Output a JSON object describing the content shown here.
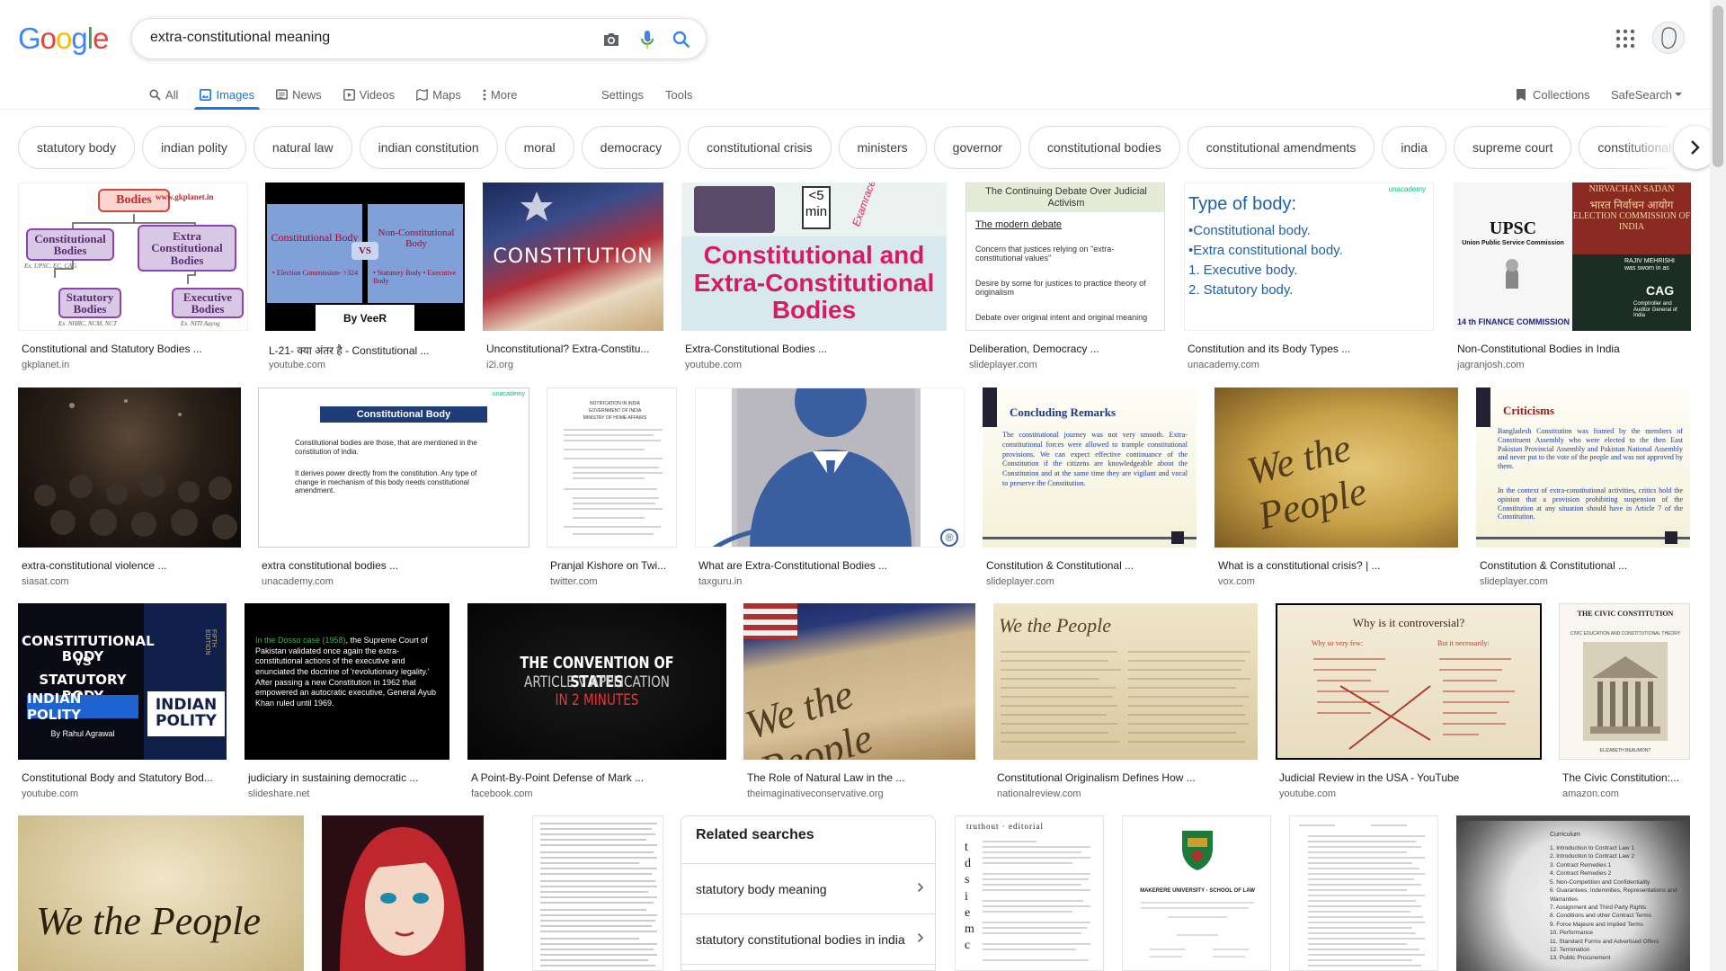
{
  "header": {
    "logo_text": "Google",
    "query": "extra-constitutional meaning",
    "tabs": [
      {
        "label": "All",
        "icon": "search-icon"
      },
      {
        "label": "Images",
        "icon": "image-icon"
      },
      {
        "label": "News",
        "icon": "news-icon"
      },
      {
        "label": "Videos",
        "icon": "video-icon"
      },
      {
        "label": "Maps",
        "icon": "map-icon"
      },
      {
        "label": "More",
        "icon": "more-vert-icon"
      }
    ],
    "settings_label": "Settings",
    "tools_label": "Tools",
    "collections_label": "Collections",
    "safesearch_label": "SafeSearch"
  },
  "chips": [
    "statutory body",
    "indian polity",
    "natural law",
    "indian constitution",
    "moral",
    "democracy",
    "constitutional crisis",
    "ministers",
    "governor",
    "constitutional bodies",
    "constitutional amendments",
    "india",
    "supreme court",
    "constitutional"
  ],
  "results": [
    {
      "caption": "Constitutional and Statutory Bodies ...",
      "source": "gkplanet.in",
      "thumb": {
        "t1": "Bodies",
        "t2": "www.gkplanet.in",
        "t3": "Constitutional Bodies",
        "t4": "Extra Constitutional Bodies",
        "t5": "Statutory Bodies",
        "t6": "Executive Bodies",
        "t7": "Ex. UPSC, EC, CAG",
        "t8": "Ex. NHRC, NCM, NCT",
        "t9": "Ex. NITI Aayog"
      }
    },
    {
      "caption": "L-21- क्या अंतर है - Constitutional ...",
      "source": "youtube.com",
      "thumb": {
        "t1": "Constitutional Body",
        "t2": "VS",
        "t3": "Non-Constitutional Body",
        "t4": "• Election Commission- >324",
        "t5": "• Statutory Body • Executive Body",
        "t6": "By VeeR"
      }
    },
    {
      "caption": "Unconstitutional? Extra-Constitu...",
      "source": "i2i.org",
      "thumb": {
        "t1": "CONSTITUTION"
      }
    },
    {
      "caption": "Extra-Constitutional Bodies ...",
      "source": "youtube.com",
      "thumb": {
        "t1": "<5 min",
        "t2": "Examrace",
        "t3": "Constitutional and Extra-Constitutional Bodies"
      }
    },
    {
      "caption": "Deliberation, Democracy ...",
      "source": "slideplayer.com",
      "thumb": {
        "t1": "The Continuing Debate Over Judicial Activism",
        "t2": "The modern debate",
        "t3": "Concern that justices relying on \"extra-constitutional values\"",
        "t4": "Desire by some for justices to practice theory of originalism",
        "t5": "Debate over original intent and original meaning"
      }
    },
    {
      "caption": "Constitution and its Body Types ...",
      "source": "unacademy.com",
      "thumb": {
        "t1": "Type of body:",
        "t2": "•Constitutional body.",
        "t3": "•Extra constitutional body.",
        "t4": "1.  Executive body.",
        "t5": "2.  Statutory body.",
        "t6": "unacademy"
      }
    },
    {
      "caption": "Non-Constitutional Bodies in India",
      "source": "jagranjosh.com",
      "thumb": {
        "t1": "UPSC",
        "t2": "Union Public Service Commission",
        "t3": "NIRVACHAN SADAN",
        "t4": "भारत निर्वाचन आयोग",
        "t5": "ELECTION COMMISSION OF INDIA",
        "t6": "RAJIV MEHRISHI was sworn in as",
        "t7": "CAG",
        "t8": "14 th FINANCE COMMISSION",
        "t9": "Comptroller and Auditor General of India"
      }
    },
    {
      "caption": "extra-constitutional violence ...",
      "source": "siasat.com",
      "thumb": {}
    },
    {
      "caption": "extra constitutional bodies ...",
      "source": "unacademy.com",
      "thumb": {
        "t1": "Constitutional Body",
        "t2": "Constitutional bodies are those, that are mentioned in the constitution of india.",
        "t3": "It derives power directly from the constitution. Any type of change in mechanism of this body needs constitutional amendment.",
        "t4": "unacademy"
      }
    },
    {
      "caption": "Pranjal Kishore on Twi...",
      "source": "twitter.com",
      "thumb": {
        "t1": "NOTIFICATION IN INDIA",
        "t2": "GOVERNMENT OF INDIA",
        "t3": "MINISTRY OF HOME AFFAIRS"
      }
    },
    {
      "caption": "What are Extra-Constitutional Bodies ...",
      "source": "taxguru.in",
      "thumb": {
        "t1": "®"
      }
    },
    {
      "caption": "Constitution & Constitutional ...",
      "source": "slideplayer.com",
      "thumb": {
        "t1": "Concluding Remarks",
        "t2": "The constitutional journey was not very smooth. Extra-constitutional forces were allowed to trample constitutional provisions. We can expect effective continuance of the Constitution if the citizens are knowledgeable about the Constitution and at the same time they are vigilant and vocal to preserve the Constitution."
      }
    },
    {
      "caption": "What is a constitutional crisis? | ...",
      "source": "vox.com",
      "thumb": {
        "t1": "We the People"
      }
    },
    {
      "caption": "Constitution & Constitutional ...",
      "source": "slideplayer.com",
      "thumb": {
        "t1": "Criticisms",
        "t2": "Bangladesh Constitution was framed by the members of Constituent Assembly who were elected to the then East Pakistan Provincial Assembly and Pakistan National Assembly and never put to the vote of the people and was not approved by them.",
        "t3": "In the context of extra-constitutional activities, critics hold the opinion that a provision prohibiting suspension of the Constitution at any situation should have in Article 7 of the Constitution."
      }
    },
    {
      "caption": "Constitutional Body and Statutory Bod...",
      "source": "youtube.com",
      "thumb": {
        "t1": "CONSTITUTIONAL BODY",
        "t2": "VS",
        "t3": "STATUTORY BODY",
        "t4": "INDIAN POLITY",
        "t5": "By Rahul Agrawal",
        "t6": "INDIAN POLITY",
        "t7": "FIFTH EDITION"
      }
    },
    {
      "caption": "judiciary in sustaining democratic ...",
      "source": "slideshare.net",
      "thumb": {
        "t1": "In the Dosso case (1958)",
        "t2": ", the Supreme Court of Pakistan validated once again the extra-constitutional actions of the executive and enunciated the doctrine of 'revolutionary legality.' After passing a new Constitution in 1962 that empowered an autocratic executive, General Ayub Khan ruled until 1969."
      }
    },
    {
      "caption": "A Point-By-Point Defense of Mark ...",
      "source": "facebook.com",
      "thumb": {
        "t1": "THE CONVENTION OF STATES",
        "t2": "ARTICLE V APPLICATION",
        "t3": "IN 2 MINUTES"
      }
    },
    {
      "caption": "The Role of Natural Law in the ...",
      "source": "theimaginativeconservative.org",
      "thumb": {
        "t1": "We the People"
      }
    },
    {
      "caption": "Constitutional Originalism Defines How ...",
      "source": "nationalreview.com",
      "thumb": {
        "t1": "We the People"
      }
    },
    {
      "caption": "Judicial Review in the USA - YouTube",
      "source": "youtube.com",
      "thumb": {
        "t1": "Why is it controversial?",
        "t2": "Why so very few:",
        "t3": "But it necessarily:"
      }
    },
    {
      "caption": "The Civic Constitution:...",
      "source": "amazon.com",
      "thumb": {
        "t1": "THE CIVIC CONSTITUTION",
        "t2": "CIVIC EDUCATION AND CONSTITUTIONAL THEORY",
        "t3": "ELIZABETH BEAUMONT"
      }
    },
    {
      "caption": "",
      "source": "",
      "thumb": {
        "t1": "We the People"
      }
    },
    {
      "caption": "",
      "source": "",
      "thumb": {}
    },
    {
      "caption": "",
      "source": "",
      "thumb": {}
    },
    {
      "caption": "",
      "source": "",
      "thumb": {
        "t1": "truthout",
        "t2": "editorial"
      }
    },
    {
      "caption": "",
      "source": "",
      "thumb": {
        "t1": "MAKERERE UNIVERSITY - SCHOOL OF LAW"
      }
    },
    {
      "caption": "",
      "source": "",
      "thumb": {}
    },
    {
      "caption": "",
      "source": "",
      "thumb": {
        "t1": "Curriculum",
        "t2": "1. Introduction to Contract Law 1",
        "t3": "2. Introduction to Contract Law 2",
        "t4": "3. Contract Remedies 1",
        "t5": "4. Contract Remedies 2",
        "t6": "5. Non-Competition and Confidentiality",
        "t7": "6. Guarantees, Indemnities, Representations and Warranties",
        "t8": "7. Assignment and Third Party Rights",
        "t9": "8. Conditions and other Contract Terms",
        "t10": "9. Force Majeure and Implied Terms",
        "t11": "10. Performance",
        "t12": "11. Standard Forms and Advertised Offers",
        "t13": "12. Termination",
        "t14": "13. Public Procurement"
      }
    }
  ],
  "related": {
    "title": "Related searches",
    "items": [
      "statutory body meaning",
      "statutory constitutional bodies in india"
    ]
  }
}
